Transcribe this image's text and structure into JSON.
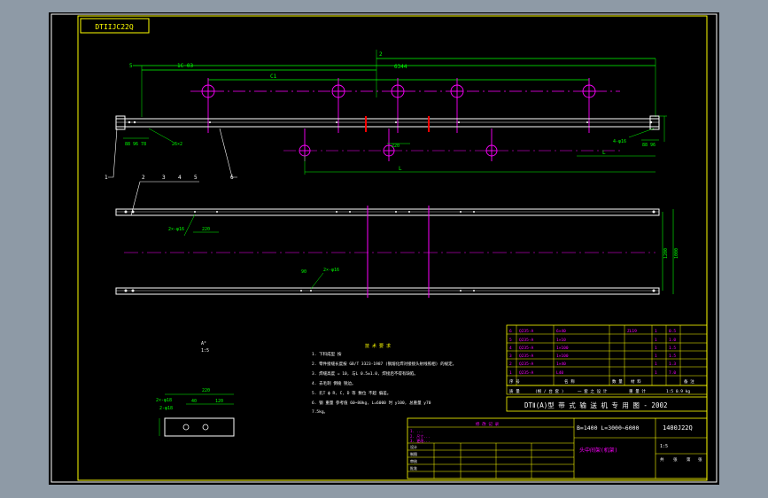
{
  "drawing": {
    "stamp": "DTIIJC22Q",
    "stamp_note": "",
    "dims": {
      "d_top1": "1C 03",
      "d_top2": "6344",
      "d_top3": "2",
      "d_top4": "C1",
      "d_left": "5",
      "d_left2": "88 96 78",
      "d_left3": "26×2",
      "d_mid1": "L",
      "d_mid2": "220",
      "d_right1": "4-φ16",
      "d_right2": "88 96",
      "d_bottom": "?",
      "d_L": "L",
      "p_hole_label": "2×-φ16",
      "p_220": "220",
      "side_1200": "1200",
      "side_1000": "1000",
      "p_90": "90",
      "p_hole2": "2×-φ16"
    },
    "callouts": [
      "1",
      "2",
      "3",
      "4",
      "5",
      "6"
    ],
    "detail_labels": {
      "title": "A°",
      "scale": "1:5",
      "dim_w": "220",
      "dim_40": "40",
      "dim_120": "120",
      "dim_h": "2×-φ18",
      "hole_label": "2-φ18"
    },
    "notes": {
      "title": "技 术 要 求",
      "lines": [
        "1. 下料成型 按",
        "2. 零件接缝长度按 GB/T 3323-1987 (钢熔化焊对接接头射线照相) 的规定。",
        "3. 焊缝高度 = 10, 与L 0.5±1.0, 焊接后不得有缺陷。",
        "4. 去毛刺 倒棱 锐边。",
        "5. 孔T ϕ  R, C, D 等 数位 不超 偏差。",
        "6. 钢 重量 参考值 60~80kg, L=6000 时 y100, 总重量 y70",
        "   7.5kg。"
      ]
    },
    "title_block": {
      "series": "DTⅡ(A)型  带 式 输 送 机 专 用 图 - 2002",
      "size_spec": "B=1400  L=3000~6000",
      "drawing_no": "1400J22Q",
      "part_name": "头中间架(机架)",
      "scale": "1:5",
      "parts_rows": [
        [
          "6",
          "Q235-A",
          "6×40",
          "",
          "ZL19",
          "1",
          "0.5"
        ],
        [
          "5",
          "Q235-A",
          "1×10",
          "",
          "",
          "1",
          "1.0"
        ],
        [
          "4",
          "Q235-A",
          "1×100",
          "",
          "",
          "1",
          "1.5"
        ],
        [
          "3",
          "Q235-A",
          "1×100",
          "",
          "",
          "1",
          "1.5"
        ],
        [
          "2",
          "Q235-A",
          "1×40",
          "",
          "",
          "1",
          "1.3"
        ],
        [
          "1",
          "Q235-A",
          "L40",
          "",
          "",
          "1",
          "7.0"
        ]
      ],
      "header": [
        "序 号",
        "名 称",
        "数 量",
        "材 料",
        "备 注"
      ],
      "weight_row": [
        "质 量",
        "(根 / 台 套 )",
        "一 套 之 设 计",
        "重 量 计",
        "1:5 0.9 kg"
      ],
      "revision": {
        "title": "修 改 记 录",
        "rows": [
          "1. ...",
          "2. 尺寸...",
          "3. 更改...",
          "4. ..."
        ]
      },
      "sign_rows": [
        "设计",
        "制图",
        "审核",
        "批准"
      ],
      "sheet": [
        "共",
        "张",
        "第",
        "张"
      ]
    }
  },
  "colors": {
    "frame": "#ffffff",
    "border": "#ffff00",
    "beam": "#ffffff",
    "centerline": "#ff00ff",
    "dim": "#00ff00",
    "notes": "#ffffff",
    "notes_title": "#ffff00",
    "red": "#ff0000",
    "cyan": "#00ffff"
  }
}
